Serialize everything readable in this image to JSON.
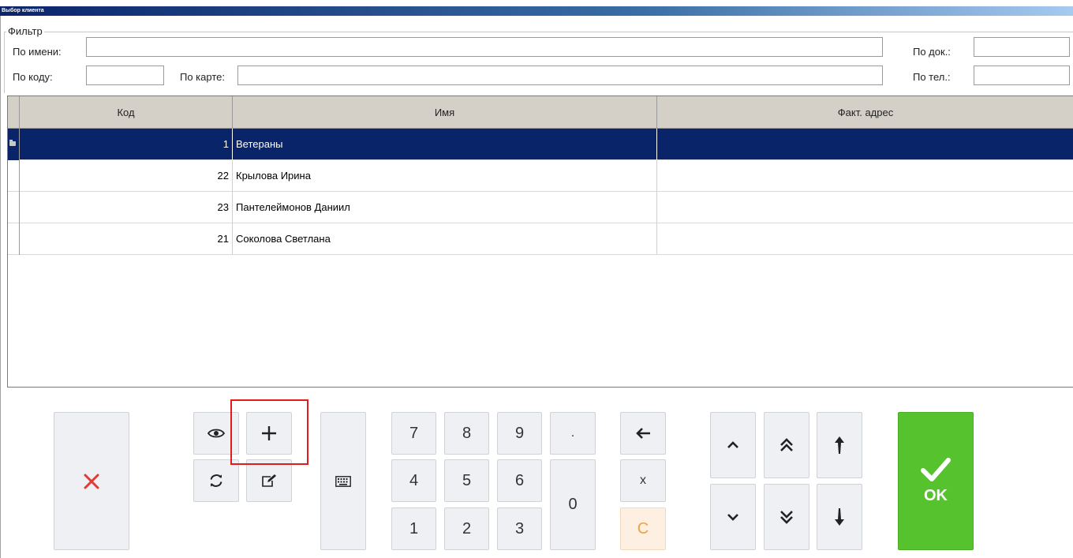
{
  "window": {
    "title": "Выбор клиента"
  },
  "filter": {
    "legend": "Фильтр",
    "by_name_label": "По имени:",
    "by_name_value": "",
    "by_doc_label": "По док.:",
    "by_doc_value": "",
    "by_code_label": "По коду:",
    "by_code_value": "",
    "by_card_label": "По карте:",
    "by_card_value": "",
    "by_phone_label": "По тел.:",
    "by_phone_value": ""
  },
  "grid": {
    "columns": [
      "Код",
      "Имя",
      "Факт. адрес"
    ],
    "rows": [
      {
        "code": "1",
        "name": "Ветераны",
        "address": "",
        "selected": true,
        "is_group": true
      },
      {
        "code": "22",
        "name": "Крылова Ирина",
        "address": ""
      },
      {
        "code": "23",
        "name": "Пантелеймонов Даниил",
        "address": ""
      },
      {
        "code": "21",
        "name": "Соколова Светлана",
        "address": ""
      }
    ]
  },
  "keypad": {
    "digits": [
      "7",
      "8",
      "9",
      ".",
      "4",
      "5",
      "6",
      "0",
      "1",
      "2",
      "3"
    ],
    "backspace_icon": "arrow-left-icon",
    "x_label": "x",
    "clear_label": "C",
    "ok_label": "OK"
  },
  "icons": {
    "cancel": "close-icon",
    "view": "eye-icon",
    "add": "plus-icon",
    "refresh": "refresh-icon",
    "edit": "edit-icon",
    "keyboard": "keyboard-icon",
    "up": "chevron-up-icon",
    "page_up": "double-chevron-up-icon",
    "first": "arrow-to-top-icon",
    "down": "chevron-down-icon",
    "page_down": "double-chevron-down-icon",
    "last": "arrow-to-bottom-icon",
    "ok": "check-icon"
  },
  "colors": {
    "selection": "#0a246a",
    "ok_button": "#56c22d",
    "cancel_x": "#e53935",
    "clear_text": "#f0a040",
    "highlight": "#e21b1b"
  }
}
